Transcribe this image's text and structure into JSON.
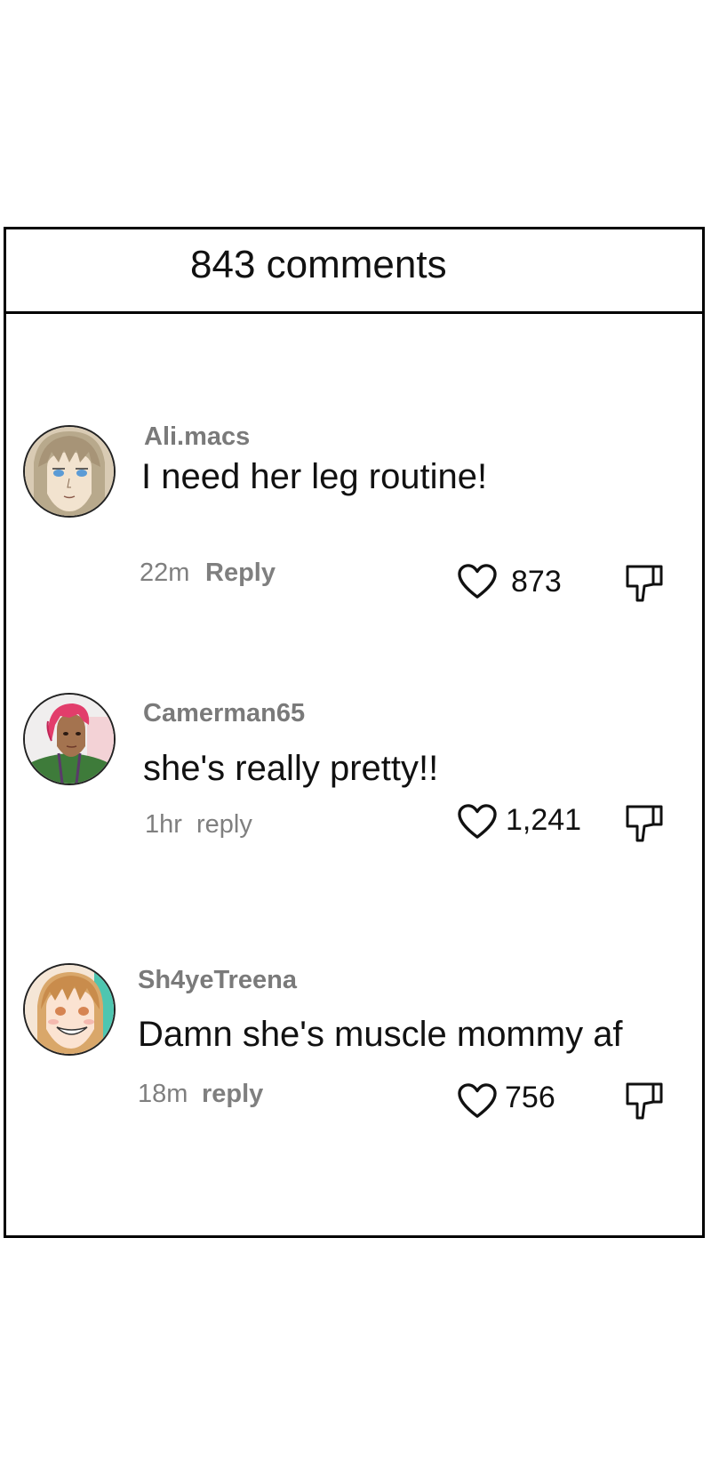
{
  "header": {
    "comment_count": "843 comments"
  },
  "comments": [
    {
      "username": "Ali.macs",
      "text": "I need her leg routine!",
      "time": "22m",
      "reply_label": "Reply",
      "likes": "873",
      "avatar_icon": "avatar-blonde-bangs"
    },
    {
      "username": "Camerman65",
      "text": "she's really pretty!!",
      "time": "1hr",
      "reply_label": "reply",
      "likes": "1,241",
      "avatar_icon": "avatar-pink-hair"
    },
    {
      "username": "Sh4yeTreena",
      "text": "Damn she's muscle mommy af",
      "time": "18m",
      "reply_label": "reply",
      "likes": "756",
      "avatar_icon": "avatar-smiling-blonde"
    }
  ],
  "icons": {
    "like": "heart-icon",
    "dislike": "thumbs-down-icon"
  },
  "colors": {
    "border": "#000000",
    "username": "#7a7a7a",
    "meta": "#7f7f7f",
    "text": "#111111"
  }
}
